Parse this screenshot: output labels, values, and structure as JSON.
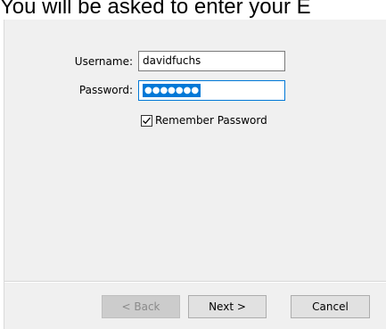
{
  "header": {
    "instruction_text": "You will be asked to enter your E"
  },
  "form": {
    "username_label": "Username:",
    "username_value": "davidfuchs",
    "password_label": "Password:",
    "password_masked": "●●●●●●●",
    "remember_label": "Remember Password",
    "remember_checked": true
  },
  "buttons": {
    "back_label": "< Back",
    "back_enabled": false,
    "next_label": "Next >",
    "cancel_label": "Cancel"
  },
  "colors": {
    "dialog_bg": "#f0f0f0",
    "focus_accent": "#0078d7",
    "button_bg": "#e1e1e1",
    "disabled_button_bg": "#cccccc"
  }
}
